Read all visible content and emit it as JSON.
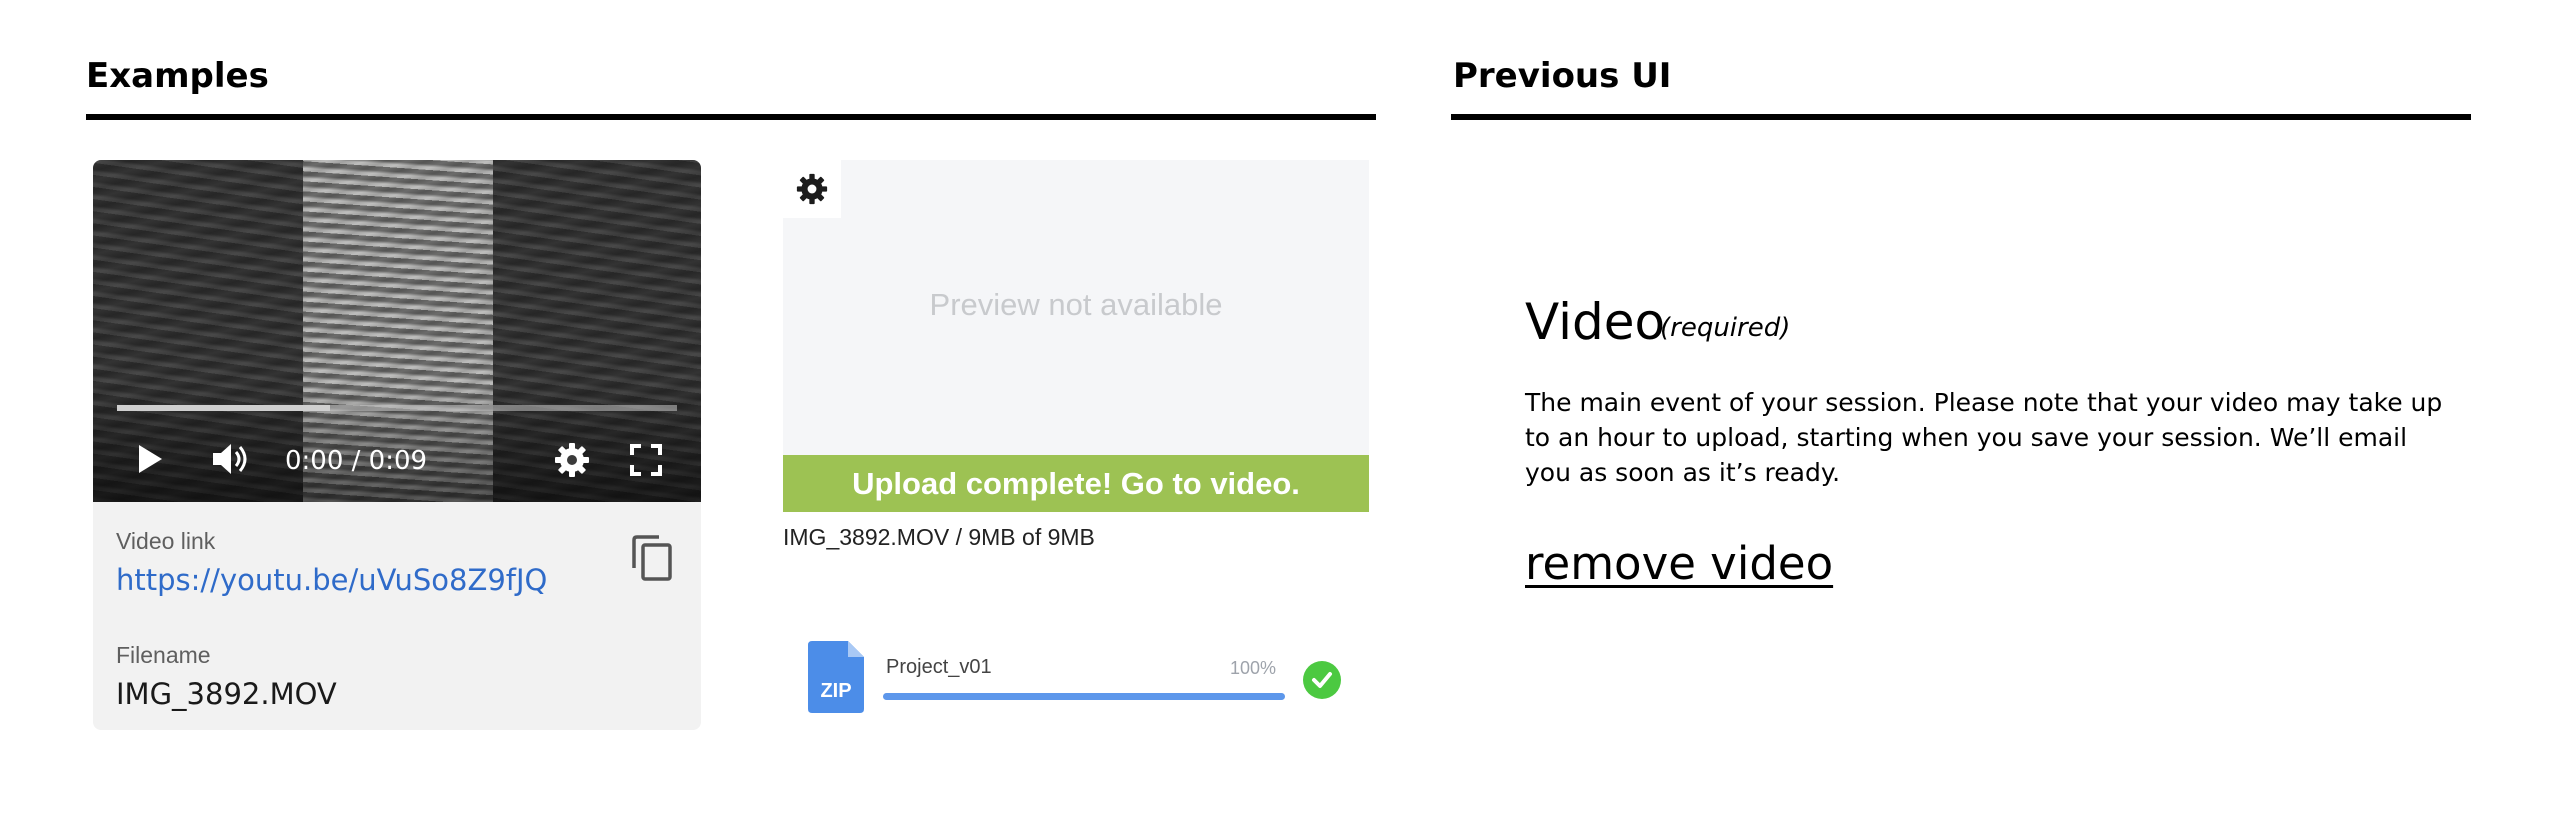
{
  "examples": {
    "title": "Examples",
    "player": {
      "time": "0:00 / 0:09",
      "progress_fraction": 0.38,
      "video_link_label": "Video link",
      "video_link": "https://youtu.be/uVuSo8Z9fJQ",
      "filename_label": "Filename",
      "filename": "IMG_3892.MOV",
      "icons": [
        "play-icon",
        "volume-icon",
        "settings-gear-icon",
        "fullscreen-icon",
        "copy-icon"
      ]
    },
    "upload": {
      "preview_text": "Preview not available",
      "complete_button": "Upload complete! Go to video.",
      "file_status": "IMG_3892.MOV / 9MB of 9MB",
      "accent_color": "#9dc253"
    },
    "zip_item": {
      "icon_text": "ZIP",
      "name": "Project_v01",
      "percent": "100%",
      "progress_fraction": 1.0,
      "status_color": "#4cc941"
    }
  },
  "previous_ui": {
    "title": "Previous UI",
    "heading": "Video",
    "required": "(required)",
    "description": "The main event of your session. Please note that your video may take up to an hour to upload, starting when you save your session. We’ll email you as soon as it’s ready.",
    "remove_link": "remove video"
  }
}
